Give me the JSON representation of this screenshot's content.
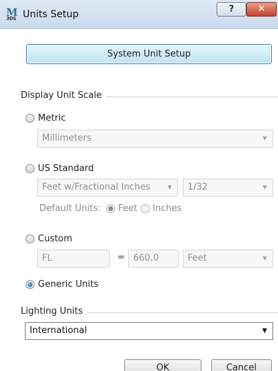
{
  "window": {
    "title": "Units Setup",
    "app_icon_letter": "M",
    "app_icon_sub": "3DS",
    "help_glyph": "?",
    "close_glyph": "✕"
  },
  "system_unit_setup_label": "System Unit Setup",
  "display_unit_scale": {
    "group_label": "Display Unit Scale",
    "metric": {
      "label": "Metric",
      "selected": false,
      "dropdown_value": "Millimeters"
    },
    "us_standard": {
      "label": "US Standard",
      "selected": false,
      "units_dropdown": "Feet w/Fractional Inches",
      "fraction_dropdown": "1/32",
      "default_units_label": "Default Units:",
      "default_feet_label": "Feet",
      "default_inches_label": "Inches",
      "default_selected": "Feet"
    },
    "custom": {
      "label": "Custom",
      "selected": false,
      "name_value": "FL",
      "equals": "=",
      "amount_value": "660,0",
      "unit_dropdown": "Feet"
    },
    "generic": {
      "label": "Generic Units",
      "selected": true
    }
  },
  "lighting_units": {
    "group_label": "Lighting Units",
    "dropdown_value": "International"
  },
  "buttons": {
    "ok": "OK",
    "cancel": "Cancel"
  },
  "icons": {
    "dropdown_arrow": "▼"
  }
}
